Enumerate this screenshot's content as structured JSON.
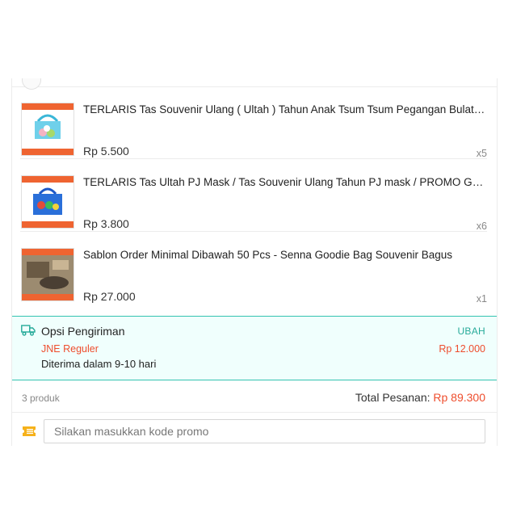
{
  "items": [
    {
      "title": "TERLARIS Tas Souvenir Ulang ( Ultah ) Tahun Anak Tsum Tsum Pegangan Bulat / G...",
      "price": "Rp 5.500",
      "qty": "x5"
    },
    {
      "title": "TERLARIS Tas Ultah PJ Mask / Tas Souvenir Ulang Tahun PJ mask / PROMO Goodi...",
      "price": "Rp 3.800",
      "qty": "x6"
    },
    {
      "title": "Sablon Order Minimal Dibawah 50 Pcs - Senna Goodie Bag Souvenir Bagus",
      "price": "Rp 27.000",
      "qty": "x1"
    }
  ],
  "shipping": {
    "label": "Opsi Pengiriman",
    "change": "UBAH",
    "courier": "JNE Reguler",
    "fee": "Rp 12.000",
    "eta": "Diterima dalam 9-10 hari",
    "icon": "truck-icon"
  },
  "summary": {
    "count": "3 produk",
    "total_label": "Total Pesanan:",
    "total_value": "Rp 89.300"
  },
  "promo": {
    "placeholder": "Silakan masukkan kode promo",
    "icon": "voucher-icon"
  },
  "colors": {
    "accent": "#ee4d2d",
    "teal": "#26aa99",
    "shipping_bg": "#f0fffd"
  }
}
